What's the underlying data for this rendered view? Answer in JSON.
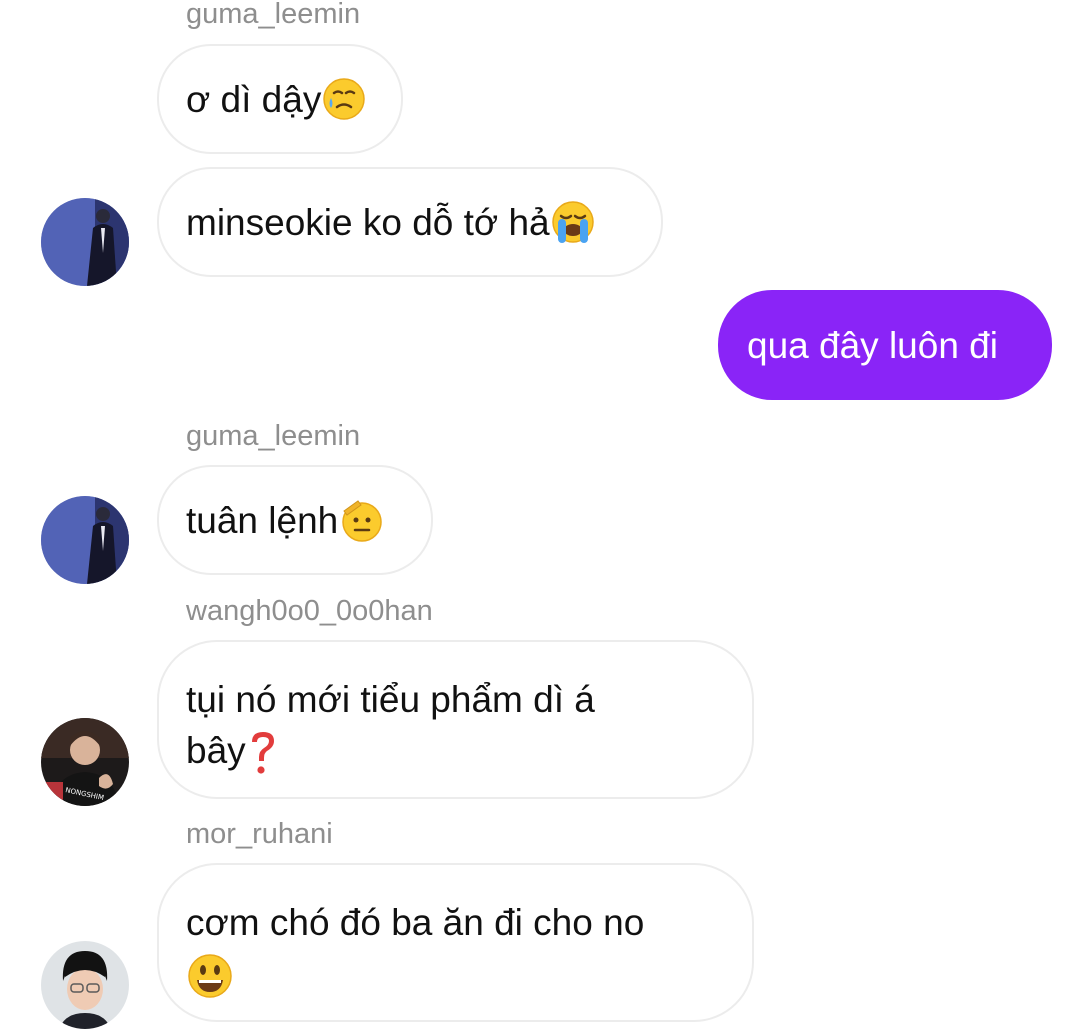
{
  "messages": [
    {
      "sender": "guma_leemin",
      "text": "ơ dì dậy",
      "emoji_name": "face-holding-back-tears-icon"
    },
    {
      "text": "minseokie ko dỗ tớ hả",
      "emoji_name": "loudly-crying-face-icon",
      "avatar_name": "avatar-guma-leemin"
    },
    {
      "text": "qua đây luôn đi",
      "outgoing": true
    },
    {
      "sender": "guma_leemin",
      "text": "tuân lệnh",
      "emoji_name": "saluting-face-icon",
      "avatar_name": "avatar-guma-leemin"
    },
    {
      "sender": "wangh0o0_0o0han",
      "line1": "tụi nó mới tiểu phẩm dì á",
      "line2": "bây",
      "emoji_name": "red-question-mark-icon",
      "avatar_name": "avatar-wangh0o0-0o0han",
      "avatar_text": "NONGSHIM"
    },
    {
      "sender": "mor_ruhani",
      "line1": "cơm chó đó ba ăn đi cho no",
      "emoji_name": "grinning-face-icon",
      "avatar_name": "avatar-mor-ruhani"
    }
  ],
  "colors": {
    "outgoing_bubble": "#8a24f7",
    "incoming_bubble_border": "#ececec",
    "username_text": "#8e8e8e",
    "message_text": "#111111"
  }
}
